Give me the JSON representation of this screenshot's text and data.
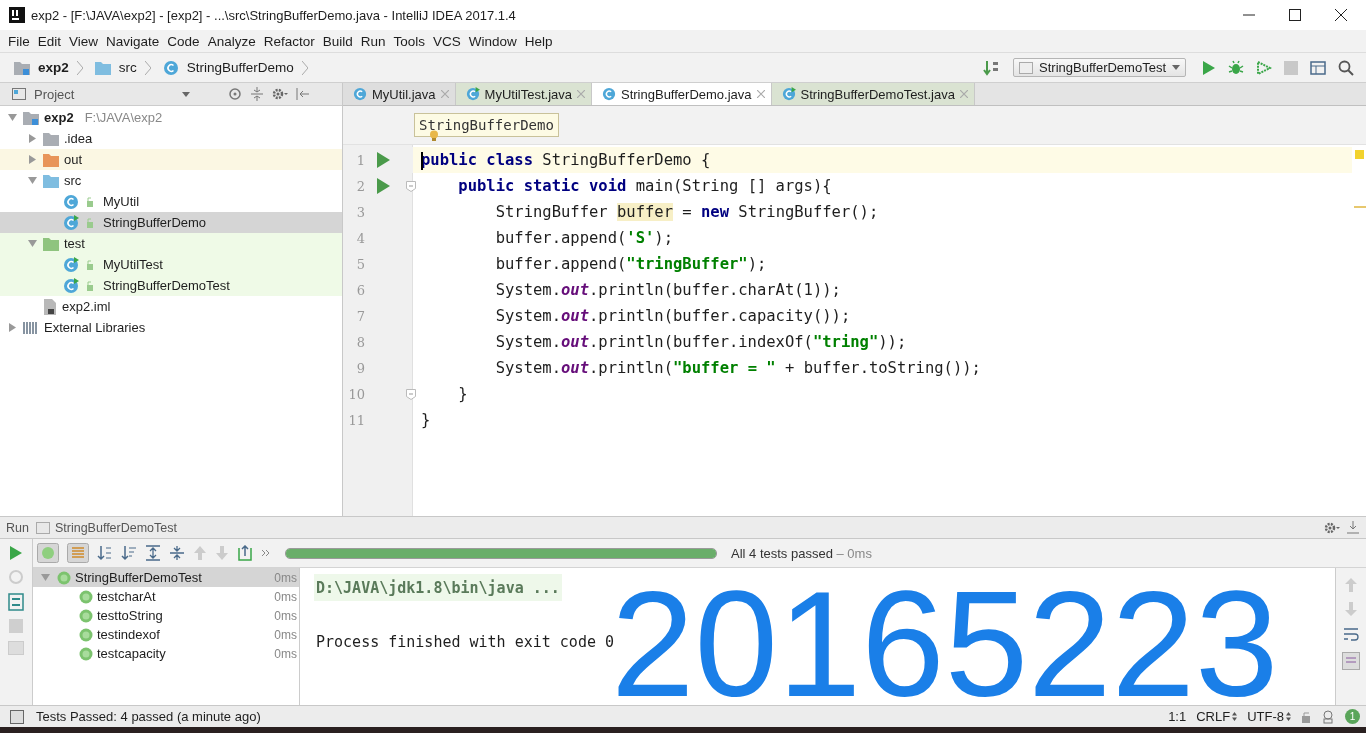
{
  "window": {
    "title": "exp2 - [F:\\JAVA\\exp2] - [exp2] - ...\\src\\StringBufferDemo.java - IntelliJ IDEA 2017.1.4"
  },
  "menu": [
    "File",
    "Edit",
    "View",
    "Navigate",
    "Code",
    "Analyze",
    "Refactor",
    "Build",
    "Run",
    "Tools",
    "VCS",
    "Window",
    "Help"
  ],
  "navbar": {
    "breadcrumbs": [
      {
        "label": "exp2",
        "kind": "module"
      },
      {
        "label": "src",
        "kind": "source-folder"
      },
      {
        "label": "StringBufferDemo",
        "kind": "class"
      }
    ],
    "run_config": "StringBufferDemoTest"
  },
  "project": {
    "title": "Project",
    "tree": [
      {
        "label": "exp2",
        "path": "F:\\JAVA\\exp2",
        "kind": "module",
        "expanded": true,
        "selected": false,
        "children": [
          {
            "label": ".idea",
            "kind": "folder",
            "expanded": false,
            "selected": false
          },
          {
            "label": "out",
            "kind": "excluded-folder",
            "expanded": false,
            "selected": false
          },
          {
            "label": "src",
            "kind": "source-folder",
            "expanded": true,
            "selected": false,
            "children": [
              {
                "label": "MyUtil",
                "kind": "class",
                "selected": false
              },
              {
                "label": "StringBufferDemo",
                "kind": "runnable-class",
                "selected": true
              }
            ]
          },
          {
            "label": "test",
            "kind": "test-folder",
            "expanded": true,
            "selected": false,
            "children": [
              {
                "label": "MyUtilTest",
                "kind": "runnable-class",
                "selected": false
              },
              {
                "label": "StringBufferDemoTest",
                "kind": "runnable-class",
                "selected": false
              }
            ]
          },
          {
            "label": "exp2.iml",
            "kind": "file",
            "selected": false
          }
        ]
      },
      {
        "label": "External Libraries",
        "kind": "library",
        "expanded": false,
        "selected": false
      }
    ]
  },
  "tabs": [
    {
      "label": "MyUtil.java",
      "kind": "source",
      "selected": false
    },
    {
      "label": "MyUtilTest.java",
      "kind": "test",
      "selected": false
    },
    {
      "label": "StringBufferDemo.java",
      "kind": "source",
      "selected": true
    },
    {
      "label": "StringBufferDemoTest.java",
      "kind": "test",
      "selected": false
    }
  ],
  "editor": {
    "breadcrumb": "StringBufferDemo",
    "lines": [
      {
        "number": "1",
        "run": true,
        "fold": false,
        "current": true,
        "tokens": [
          {
            "text": "public class",
            "kind": "keyword"
          },
          {
            "text": " StringBufferDemo {",
            "kind": "plain"
          }
        ]
      },
      {
        "number": "2",
        "run": true,
        "fold": true,
        "current": false,
        "tokens": [
          {
            "text": "    public static void",
            "kind": "keyword"
          },
          {
            "text": " main(String [] args){",
            "kind": "plain"
          }
        ]
      },
      {
        "number": "3",
        "run": false,
        "fold": false,
        "current": false,
        "tokens": [
          {
            "text": "        StringBuffer ",
            "kind": "plain"
          },
          {
            "text": "buffer",
            "kind": "match"
          },
          {
            "text": " = ",
            "kind": "plain"
          },
          {
            "text": "new",
            "kind": "keyword"
          },
          {
            "text": " StringBuffer();",
            "kind": "plain"
          }
        ]
      },
      {
        "number": "4",
        "run": false,
        "fold": false,
        "current": false,
        "tokens": [
          {
            "text": "        buffer.append(",
            "kind": "plain"
          },
          {
            "text": "'S'",
            "kind": "string"
          },
          {
            "text": ");",
            "kind": "plain"
          }
        ]
      },
      {
        "number": "5",
        "run": false,
        "fold": false,
        "current": false,
        "tokens": [
          {
            "text": "        buffer.append(",
            "kind": "plain"
          },
          {
            "text": "\"tringBuffer\"",
            "kind": "string"
          },
          {
            "text": ");",
            "kind": "plain"
          }
        ]
      },
      {
        "number": "6",
        "run": false,
        "fold": false,
        "current": false,
        "tokens": [
          {
            "text": "        System.",
            "kind": "plain"
          },
          {
            "text": "out",
            "kind": "field"
          },
          {
            "text": ".println(buffer.charAt(1));",
            "kind": "plain"
          }
        ]
      },
      {
        "number": "7",
        "run": false,
        "fold": false,
        "current": false,
        "tokens": [
          {
            "text": "        System.",
            "kind": "plain"
          },
          {
            "text": "out",
            "kind": "field"
          },
          {
            "text": ".println(buffer.capacity());",
            "kind": "plain"
          }
        ]
      },
      {
        "number": "8",
        "run": false,
        "fold": false,
        "current": false,
        "tokens": [
          {
            "text": "        System.",
            "kind": "plain"
          },
          {
            "text": "out",
            "kind": "field"
          },
          {
            "text": ".println(buffer.indexOf(",
            "kind": "plain"
          },
          {
            "text": "\"tring\"",
            "kind": "string"
          },
          {
            "text": "));",
            "kind": "plain"
          }
        ]
      },
      {
        "number": "9",
        "run": false,
        "fold": false,
        "current": false,
        "tokens": [
          {
            "text": "        System.",
            "kind": "plain"
          },
          {
            "text": "out",
            "kind": "field"
          },
          {
            "text": ".println(",
            "kind": "plain"
          },
          {
            "text": "\"buffer = \"",
            "kind": "string"
          },
          {
            "text": " + buffer.toString());",
            "kind": "plain"
          }
        ]
      },
      {
        "number": "10",
        "run": false,
        "fold": true,
        "current": false,
        "tokens": [
          {
            "text": "    }",
            "kind": "plain"
          }
        ]
      },
      {
        "number": "11",
        "run": false,
        "fold": false,
        "current": false,
        "tokens": [
          {
            "text": "}",
            "kind": "plain"
          }
        ]
      }
    ]
  },
  "run": {
    "title": "Run",
    "config": "StringBufferDemoTest",
    "progress": {
      "level": 1
    },
    "summary": "All 4 tests passed",
    "duration": "– 0ms",
    "tests": [
      {
        "label": "StringBufferDemoTest",
        "time": "0ms",
        "expanded": true,
        "selected": true,
        "children": [
          {
            "label": "testcharAt",
            "time": "0ms",
            "selected": false
          },
          {
            "label": "testtoString",
            "time": "0ms",
            "selected": false
          },
          {
            "label": "testindexof",
            "time": "0ms",
            "selected": false
          },
          {
            "label": "testcapacity",
            "time": "0ms",
            "selected": false
          }
        ]
      }
    ],
    "console": [
      {
        "text": "D:\\JAVA\\jdk1.8\\bin\\java ...",
        "kind": "command"
      },
      {
        "text": "Process finished with exit code 0",
        "kind": "output"
      }
    ],
    "overlay": "20165223"
  },
  "status": {
    "message": "Tests Passed: 4 passed (a minute ago)",
    "position": "1:1",
    "line_separator": "CRLF",
    "encoding": "UTF-8",
    "notifications": "1"
  }
}
